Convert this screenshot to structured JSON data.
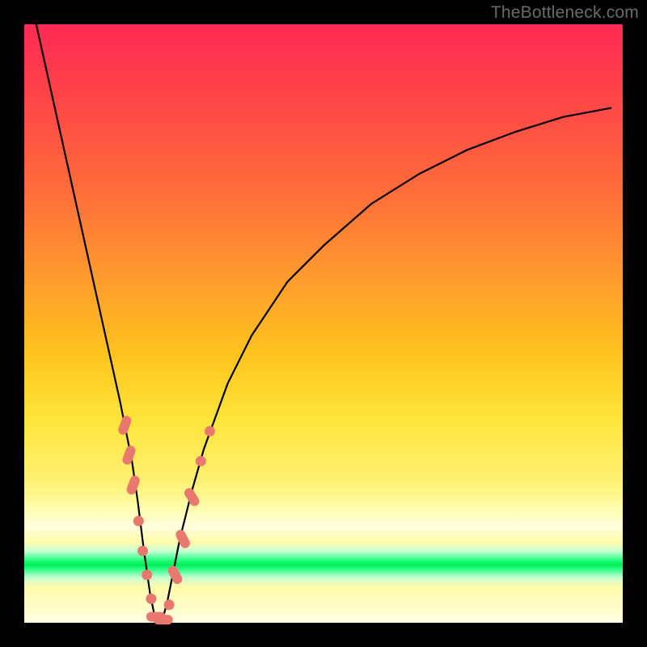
{
  "watermark": "TheBottleneck.com",
  "chart_data": {
    "type": "line",
    "title": "",
    "xlabel": "",
    "ylabel": "",
    "xlim": [
      0,
      100
    ],
    "ylim": [
      0,
      100
    ],
    "grid": false,
    "legend": false,
    "series": [
      {
        "name": "bottleneck-curve",
        "x": [
          2,
          4,
          6,
          8,
          10,
          12,
          14,
          16,
          18,
          19,
          20,
          21,
          22,
          23,
          24,
          25,
          26,
          28,
          30,
          34,
          38,
          44,
          50,
          58,
          66,
          74,
          82,
          90,
          98
        ],
        "y": [
          100,
          91,
          82,
          73,
          64,
          55,
          46,
          37,
          27,
          20,
          12,
          5,
          0,
          0,
          4,
          9,
          14,
          22,
          29,
          40,
          48,
          57,
          63,
          70,
          75,
          79,
          82,
          84.5,
          86
        ]
      }
    ],
    "markers": {
      "name": "highlight-points",
      "style": "salmon-dots-and-pills",
      "points": [
        {
          "x": 16.8,
          "y": 33,
          "type": "pill",
          "angle": -70
        },
        {
          "x": 17.5,
          "y": 28,
          "type": "pill",
          "angle": -70
        },
        {
          "x": 18.2,
          "y": 23,
          "type": "pill",
          "angle": -70
        },
        {
          "x": 19.1,
          "y": 17,
          "type": "dot"
        },
        {
          "x": 19.8,
          "y": 12,
          "type": "dot"
        },
        {
          "x": 20.5,
          "y": 8,
          "type": "dot"
        },
        {
          "x": 21.2,
          "y": 4,
          "type": "dot"
        },
        {
          "x": 22.0,
          "y": 1,
          "type": "pill",
          "angle": 0
        },
        {
          "x": 23.2,
          "y": 0.5,
          "type": "pill",
          "angle": 0
        },
        {
          "x": 24.2,
          "y": 3,
          "type": "dot"
        },
        {
          "x": 25.2,
          "y": 8,
          "type": "pill",
          "angle": 62
        },
        {
          "x": 26.5,
          "y": 14,
          "type": "pill",
          "angle": 62
        },
        {
          "x": 28.0,
          "y": 21,
          "type": "pill",
          "angle": 58
        },
        {
          "x": 29.5,
          "y": 27,
          "type": "dot"
        },
        {
          "x": 31.0,
          "y": 32,
          "type": "dot"
        }
      ]
    },
    "background_gradient": {
      "orientation": "vertical",
      "stops": [
        {
          "pos": 0.0,
          "color": "#ff2a55"
        },
        {
          "pos": 0.28,
          "color": "#ff6d3a"
        },
        {
          "pos": 0.55,
          "color": "#ffc31e"
        },
        {
          "pos": 0.8,
          "color": "#fffb9e"
        },
        {
          "pos": 0.9,
          "color": "#00ef52"
        },
        {
          "pos": 1.0,
          "color": "#fffde0"
        }
      ]
    }
  }
}
